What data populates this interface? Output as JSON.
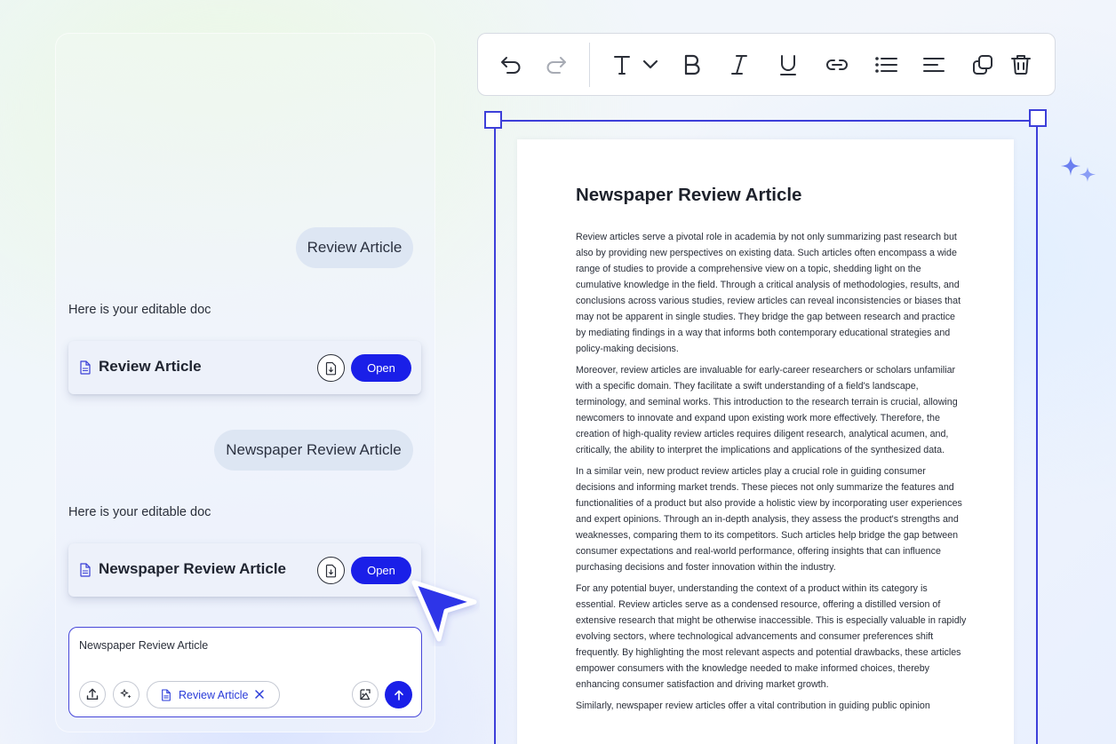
{
  "chat": {
    "messages": [
      {
        "role": "user",
        "text": "Review Article"
      },
      {
        "role": "assistant",
        "text": "Here is your editable doc",
        "doc_title": "Review Article",
        "open_label": "Open"
      },
      {
        "role": "user",
        "text": "Newspaper Review Article"
      },
      {
        "role": "assistant",
        "text": "Here is your editable doc",
        "doc_title": "Newspaper Review Article",
        "open_label": "Open"
      }
    ],
    "input": {
      "value": "Newspaper Review Article",
      "chip_label": "Review Article"
    }
  },
  "toolbar": {
    "buttons": [
      "undo-icon",
      "redo-icon",
      "text-style-icon",
      "bold-icon",
      "italic-icon",
      "underline-icon",
      "link-icon",
      "list-icon",
      "align-icon",
      "duplicate-icon",
      "delete-icon"
    ]
  },
  "document": {
    "title": "Newspaper Review Article",
    "paragraphs": [
      "Review articles serve a pivotal role in academia by not only summarizing past research but also by providing new perspectives on existing data. Such articles often encompass a wide range of studies to provide a comprehensive view on a topic, shedding light on the cumulative knowledge in the field. Through a critical analysis of methodologies, results, and conclusions across various studies, review articles can reveal inconsistencies or biases that may not be apparent in single studies. They bridge the gap between research and practice by mediating findings in a way that informs both contemporary educational strategies and policy-making decisions.",
      "Moreover, review articles are invaluable for early-career researchers or scholars unfamiliar with a specific domain. They facilitate a swift understanding of a field's landscape, terminology, and seminal works. This introduction to the research terrain is crucial, allowing newcomers to innovate and expand upon existing work more effectively. Therefore, the creation of high-quality review articles requires diligent research, analytical acumen, and, critically, the ability to interpret the implications and applications of the synthesized data.",
      "In a similar vein, new product review articles play a crucial role in guiding consumer decisions and informing market trends. These pieces not only summarize the features and functionalities of a product but also provide a holistic view by incorporating user experiences and expert opinions. Through an in-depth analysis, they assess the product's strengths and weaknesses, comparing them to its competitors. Such articles help bridge the gap between consumer expectations and real-world performance, offering insights that can influence purchasing decisions and foster innovation within the industry.",
      "For any potential buyer, understanding the context of a product within its category is essential. Review articles serve as a condensed resource, offering a distilled version of extensive research that might be otherwise inaccessible. This is especially valuable in rapidly evolving sectors, where technological advancements and consumer preferences shift frequently. By highlighting the most relevant aspects and potential drawbacks, these articles empower consumers with the knowledge needed to make informed choices, thereby enhancing consumer satisfaction and driving market growth.",
      "Similarly, newspaper review articles offer a vital contribution in guiding public opinion"
    ]
  },
  "colors": {
    "accent": "#1a1fe8",
    "selection": "#3d3fd9",
    "bubble": "#dde6f3",
    "card": "#edf1fa"
  }
}
